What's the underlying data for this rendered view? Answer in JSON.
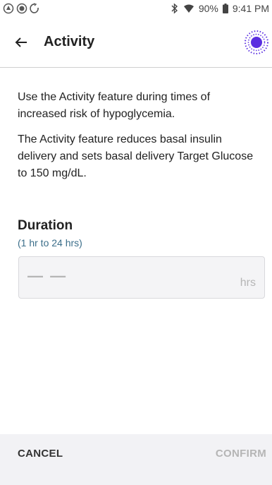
{
  "status_bar": {
    "battery": "90%",
    "time": "9:41 PM"
  },
  "app_bar": {
    "title": "Activity"
  },
  "body": {
    "paragraph_1": "Use the Activity feature during times of increased risk of hypoglycemia.",
    "paragraph_2": "The Activity feature reduces basal insulin delivery and sets basal delivery Target Glucose to 150 mg/dL."
  },
  "duration": {
    "title": "Duration",
    "range": "(1 hr to 24 hrs)",
    "value": "— —",
    "unit": "hrs"
  },
  "actions": {
    "cancel_label": "CANCEL",
    "confirm_label": "CONFIRM"
  },
  "colors": {
    "accent": "#5a2ee0",
    "range_text": "#3b6e8a",
    "disabled": "#b5b5b5"
  }
}
